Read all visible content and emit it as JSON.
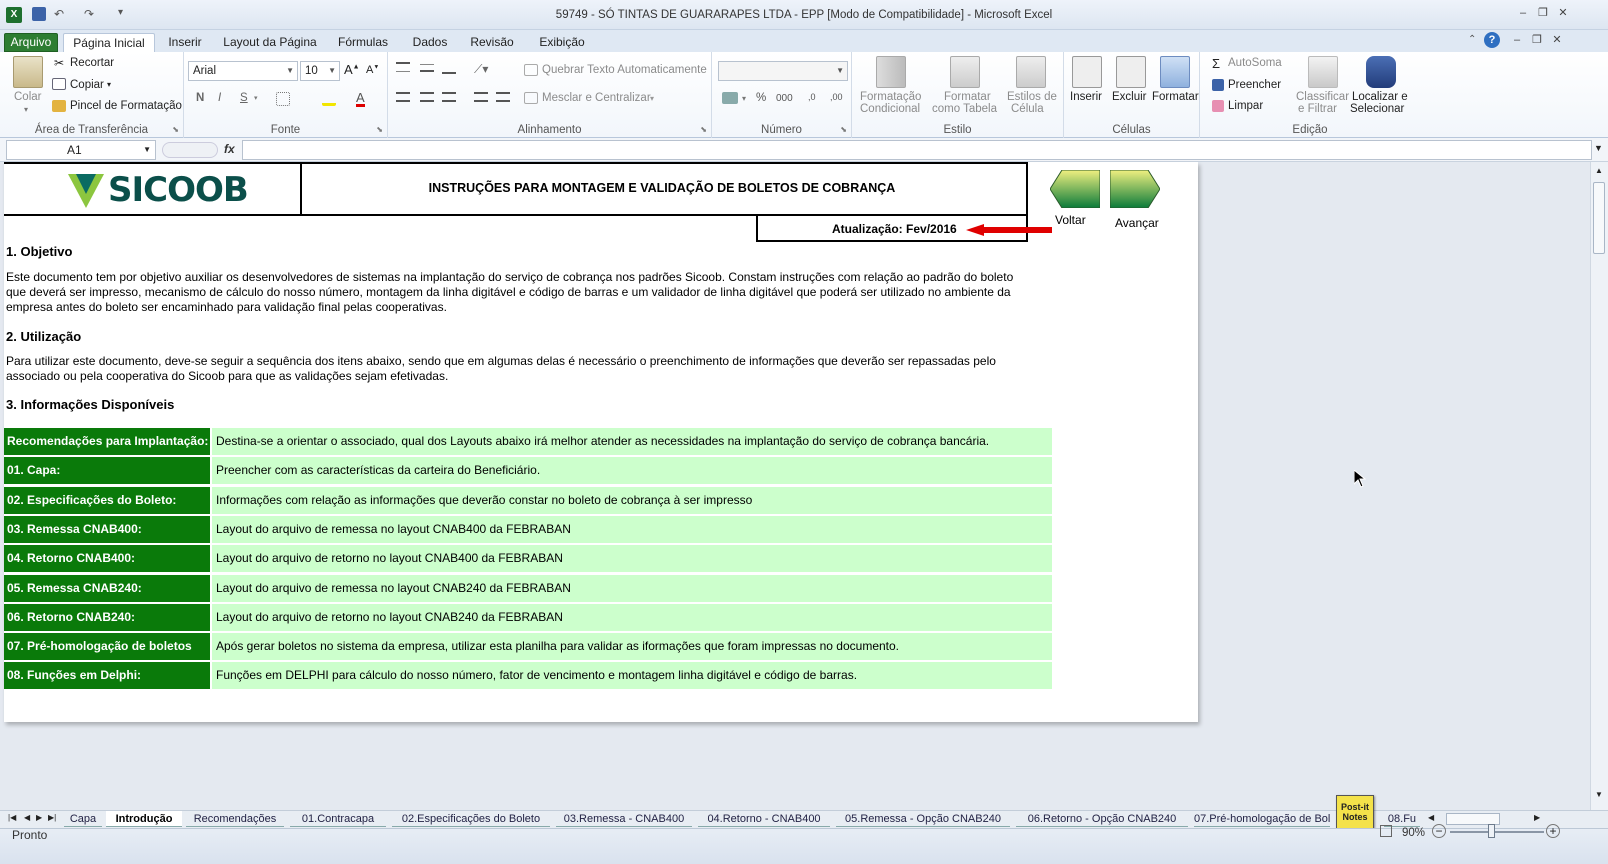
{
  "window": {
    "title": "59749 - SÓ TINTAS DE GUARARAPES LTDA - EPP  [Modo de Compatibilidade]  -  Microsoft Excel"
  },
  "tabs": [
    "Arquivo",
    "Página Inicial",
    "Inserir",
    "Layout da Página",
    "Fórmulas",
    "Dados",
    "Revisão",
    "Exibição"
  ],
  "ribbon": {
    "clipboard": {
      "paste": "Colar",
      "cut": "Recortar",
      "copy": "Copiar",
      "painter": "Pincel de Formatação",
      "label": "Área de Transferência"
    },
    "font": {
      "name": "Arial",
      "size": "10",
      "label": "Fonte",
      "bold": "N",
      "italic": "I",
      "underline": "S"
    },
    "alignment": {
      "wrap": "Quebrar Texto Automaticamente",
      "merge": "Mesclar e Centralizar",
      "label": "Alinhamento"
    },
    "number": {
      "label": "Número",
      "percent": "%",
      "thousands": "000"
    },
    "styles": {
      "cond1": "Formatação",
      "cond2": "Condicional",
      "table1": "Formatar",
      "table2": "como Tabela",
      "cell1": "Estilos de",
      "cell2": "Célula",
      "label": "Estilo"
    },
    "cells": {
      "insert": "Inserir",
      "delete": "Excluir",
      "format": "Formatar",
      "label": "Células"
    },
    "editing": {
      "autosum": "AutoSoma",
      "fill": "Preencher",
      "clear": "Limpar",
      "sort1": "Classificar",
      "sort2": "e Filtrar",
      "find1": "Localizar e",
      "find2": "Selecionar",
      "label": "Edição"
    }
  },
  "formula_bar": {
    "cell": "A1",
    "fx": "fx",
    "value": ""
  },
  "sheet": {
    "logo": "SICOOB",
    "heading": "INSTRUÇÕES PARA MONTAGEM E VALIDAÇÃO DE BOLETOS DE COBRANÇA",
    "update": "Atualização: Fev/2016",
    "nav_back": "Voltar",
    "nav_next": "Avançar",
    "s1_title": "1. Objetivo",
    "s1_text": [
      "Este documento tem por objetivo auxiliar os desenvolvedores de sistemas na implantação do serviço de cobrança nos padrões Sicoob. Constam instruções com relação ao padrão do boleto",
      "que deverá ser impresso, mecanismo de cálculo do nosso número, montagem da linha digitável e código de barras e um validador de linha digitável que poderá ser utilizado  no ambiente da",
      "empresa antes do boleto ser encaminhado para validação final pelas cooperativas."
    ],
    "s2_title": "2. Utilização",
    "s2_text": [
      "Para utilizar este documento, deve-se seguir a sequência dos itens abaixo, sendo que em algumas delas é necessário o preenchimento de informações que deverão ser repassadas pelo",
      "associado ou pela cooperativa do Sicoob para que as validações sejam efetivadas."
    ],
    "s3_title": "3. Informações Disponíveis",
    "rows": [
      {
        "label": "Recomendações para Implantação:",
        "desc": "Destina-se a orientar o associado, qual dos Layouts abaixo irá melhor atender as necessidades na implantação do serviço de cobrança bancária."
      },
      {
        "label": "01. Capa:",
        "desc": "Preencher com as características da carteira do Beneficiário."
      },
      {
        "label": "02. Especificações do Boleto:",
        "desc": "Informações com relação as informações que deverão constar no boleto de cobrança à ser impresso"
      },
      {
        "label": "03. Remessa CNAB400:",
        "desc": "Layout do arquivo de remessa no layout CNAB400 da FEBRABAN"
      },
      {
        "label": "04. Retorno CNAB400:",
        "desc": "Layout do arquivo de retorno no layout CNAB400 da FEBRABAN"
      },
      {
        "label": "05. Remessa CNAB240:",
        "desc": "Layout do arquivo de remessa no layout CNAB240 da FEBRABAN"
      },
      {
        "label": "06. Retorno CNAB240:",
        "desc": "Layout do arquivo de retorno no layout CNAB240 da FEBRABAN"
      },
      {
        "label": "07. Pré-homologação de boletos",
        "desc": "Após gerar boletos no sistema da empresa, utilizar esta planilha para validar as iformações que foram impressas no documento."
      },
      {
        "label": "08. Funções em Delphi:",
        "desc": "Funções em DELPHI para cálculo do nosso número, fator de vencimento e montagem linha digitável e código de barras."
      }
    ]
  },
  "sheet_tabs": [
    "Capa",
    "Introdução",
    "Recomendações",
    "01.Contracapa",
    "02.Especificações do Boleto",
    "03.Remessa - CNAB400",
    "04.Retorno - CNAB400",
    "05.Remessa - Opção CNAB240",
    "06.Retorno - Opção CNAB240",
    "07.Pré-homologação de Bol",
    "08.Fu"
  ],
  "status": {
    "ready": "Pronto",
    "zoom": "90%",
    "postit1": "Post-it",
    "postit2": "Notes"
  },
  "colors": {
    "label_green": "#0a7a0a",
    "row_green": "#ccffcc",
    "excel_green": "#2d7d32"
  }
}
